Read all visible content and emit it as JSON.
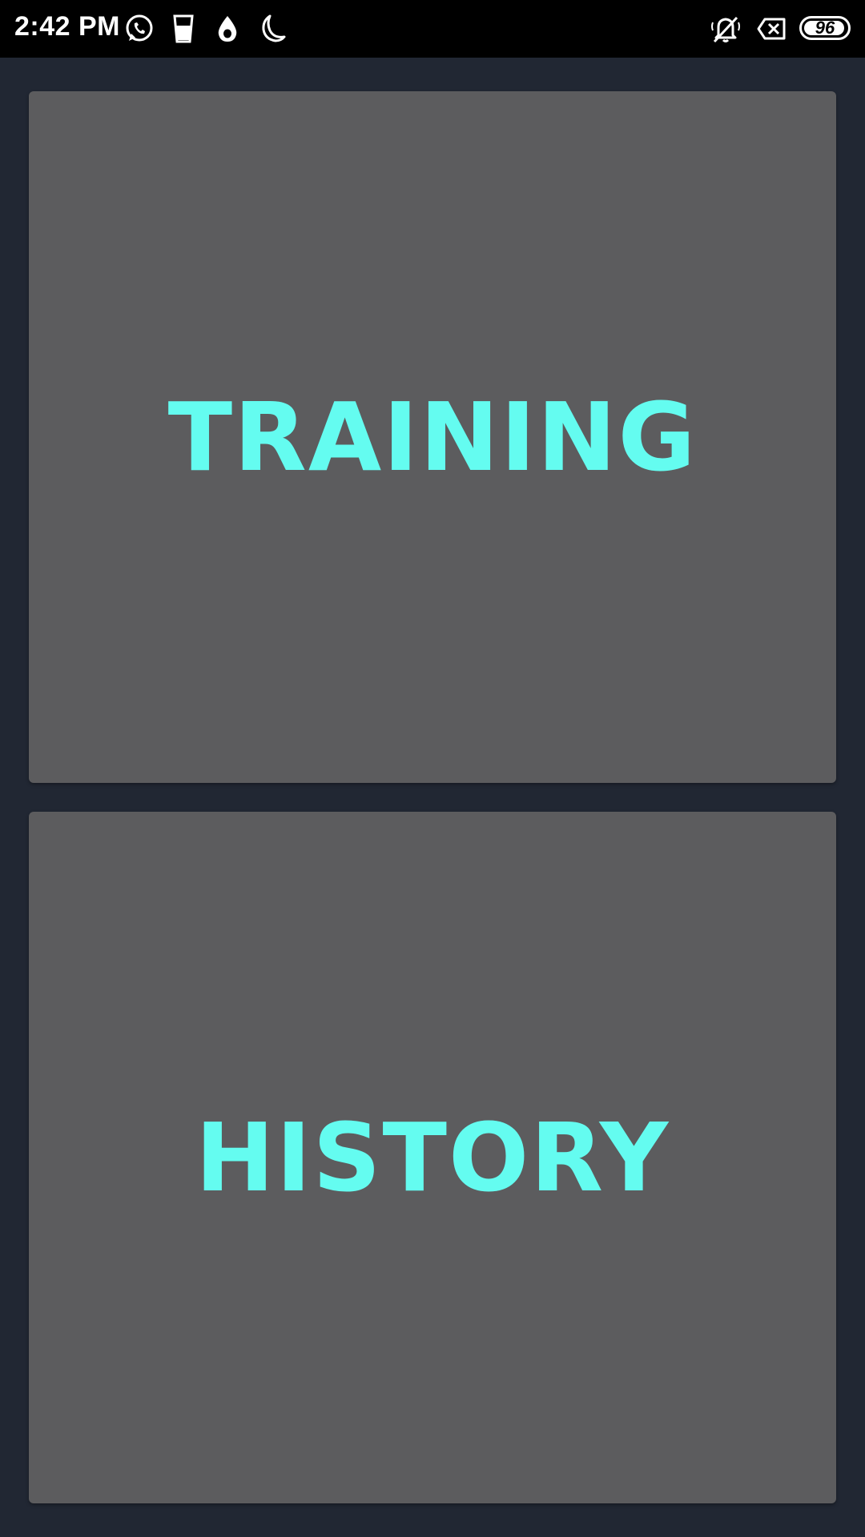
{
  "status_bar": {
    "time": "2:42 PM",
    "left_icons": [
      "whatsapp-icon",
      "glass-icon",
      "drop-icon",
      "moon-icon"
    ],
    "right_icons": [
      "bell-off-icon",
      "close-box-icon"
    ],
    "battery_level": "96",
    "battery_fraction": 0.96
  },
  "colors": {
    "background": "#212733",
    "card": "#5c5c5e",
    "accent_text": "#64fcf0",
    "status_bar": "#000000"
  },
  "menu": {
    "training_label": "TRAINING",
    "history_label": "HISTORY"
  }
}
